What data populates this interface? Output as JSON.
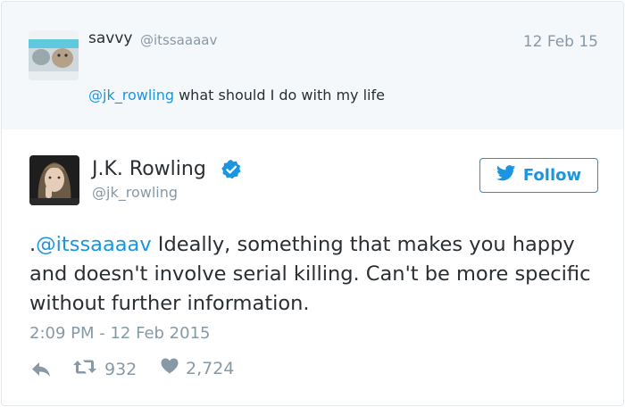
{
  "parent_tweet": {
    "display_name": "savvy",
    "handle": "@itssaaaav",
    "date": "12 Feb 15",
    "mention": "@jk_rowling",
    "text": " what should I do with my life"
  },
  "main_tweet": {
    "display_name": "J.K. Rowling",
    "handle": "@jk_rowling",
    "verified": true,
    "follow_label": "Follow",
    "text_prefix": ".",
    "mention": "@itssaaaav",
    "text": " Ideally, something that makes you happy and doesn't involve serial killing. Can't be more specific without further information.",
    "timestamp": "2:09 PM - 12 Feb 2015",
    "retweets": "932",
    "likes": "2,724"
  },
  "icons": {
    "reply": "reply-icon",
    "retweet": "retweet-icon",
    "like": "heart-icon",
    "verified": "verified-badge-icon",
    "follow": "twitter-bird-icon"
  },
  "colors": {
    "accent": "#1b95e0",
    "muted": "#8899a6",
    "text": "#292f33",
    "parent_bg": "#f5f8fa"
  }
}
